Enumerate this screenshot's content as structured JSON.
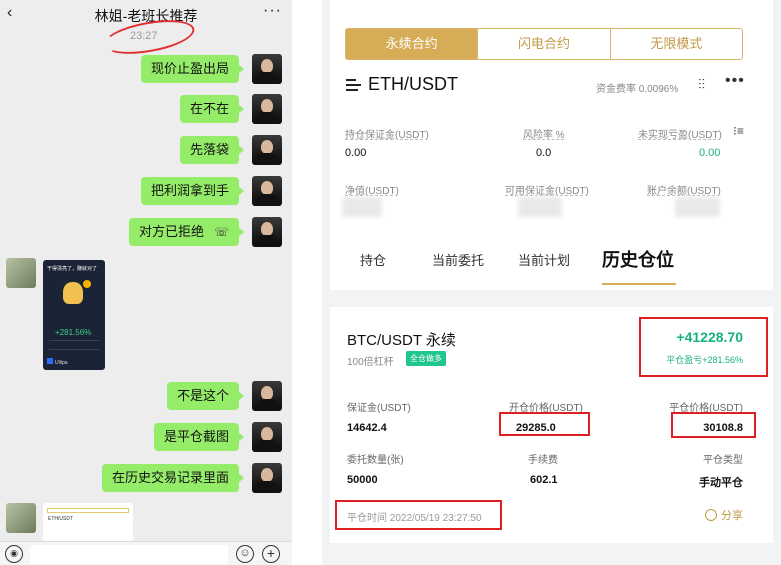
{
  "chat": {
    "title": "林姐-老班长推荐",
    "more": "···",
    "back": "‹",
    "time": "23:27",
    "messages": [
      {
        "text": "现价止盈出局"
      },
      {
        "text": "在不在"
      },
      {
        "text": "先落袋"
      },
      {
        "text": "把利润拿到手"
      },
      {
        "text": "对方已拒绝"
      },
      {
        "text": "不是这个"
      },
      {
        "text": "是平仓截图"
      },
      {
        "text": "在历史交易记录里面"
      }
    ],
    "call_glyph": "☏",
    "image_card": {
      "headline": "干得漂亮了，赚就对了",
      "pnl": "+281.56%",
      "logo": "Ullipa"
    },
    "preview_card": {
      "pair": "ETH/USDT"
    },
    "input_bar": {
      "voice_glyph": "◉",
      "emoji_glyph": "☺",
      "plus_glyph": "+"
    }
  },
  "exchange": {
    "mode_tabs": [
      "永续合约",
      "闪电合约",
      "无限模式"
    ],
    "active_mode": 0,
    "pair": "ETH/USDT",
    "funding": "资金费率 0.0096%",
    "stats": {
      "margin_label": "持仓保证金(USDT)",
      "margin_value": "0.00",
      "risk_label": "风险率 %",
      "risk_value": "0.0",
      "upnl_label": "未实现亏盈(USDT)",
      "upnl_value": "0.00",
      "equity_label": "净值(USDT)",
      "available_label": "可用保证金(USDT)",
      "balance_label": "账户余额(USDT)"
    },
    "sub_tabs": [
      "持仓",
      "当前委托",
      "当前计划",
      "历史仓位"
    ],
    "active_sub_tab": 3,
    "position": {
      "title": "BTC/USDT 永续",
      "leverage": "100倍杠杆",
      "badge": "全仓做多",
      "pnl": "+41228.70",
      "pnl_label": "平仓盈亏+281.56%",
      "margin_label": "保证金(USDT)",
      "margin_value": "14642.4",
      "open_label": "开仓价格(USDT)",
      "open_value": "29285.0",
      "close_label": "平仓价格(USDT)",
      "close_value": "30108.8",
      "qty_label": "委托数量(张)",
      "qty_value": "50000",
      "fee_label": "手续费",
      "fee_value": "602.1",
      "type_label": "平仓类型",
      "type_value": "手动平仓",
      "close_time": "平仓时间 2022/05/19 23:27:50",
      "share": "分享"
    },
    "accent_color": "#d6ac57",
    "profit_color": "#18b27a"
  }
}
